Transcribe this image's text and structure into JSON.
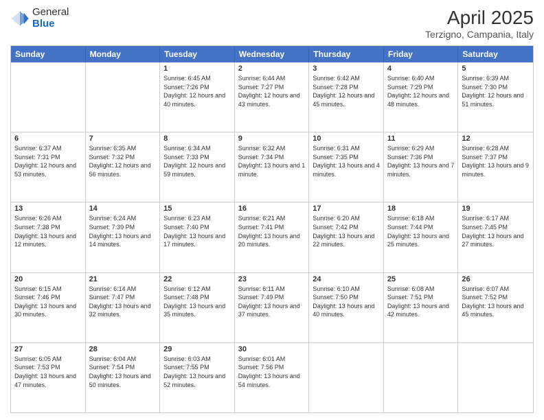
{
  "logo": {
    "general": "General",
    "blue": "Blue"
  },
  "title": "April 2025",
  "subtitle": "Terzigno, Campania, Italy",
  "weekdays": [
    "Sunday",
    "Monday",
    "Tuesday",
    "Wednesday",
    "Thursday",
    "Friday",
    "Saturday"
  ],
  "weeks": [
    [
      {
        "day": "",
        "info": ""
      },
      {
        "day": "",
        "info": ""
      },
      {
        "day": "1",
        "info": "Sunrise: 6:45 AM\nSunset: 7:26 PM\nDaylight: 12 hours and 40 minutes."
      },
      {
        "day": "2",
        "info": "Sunrise: 6:44 AM\nSunset: 7:27 PM\nDaylight: 12 hours and 43 minutes."
      },
      {
        "day": "3",
        "info": "Sunrise: 6:42 AM\nSunset: 7:28 PM\nDaylight: 12 hours and 45 minutes."
      },
      {
        "day": "4",
        "info": "Sunrise: 6:40 AM\nSunset: 7:29 PM\nDaylight: 12 hours and 48 minutes."
      },
      {
        "day": "5",
        "info": "Sunrise: 6:39 AM\nSunset: 7:30 PM\nDaylight: 12 hours and 51 minutes."
      }
    ],
    [
      {
        "day": "6",
        "info": "Sunrise: 6:37 AM\nSunset: 7:31 PM\nDaylight: 12 hours and 53 minutes."
      },
      {
        "day": "7",
        "info": "Sunrise: 6:35 AM\nSunset: 7:32 PM\nDaylight: 12 hours and 56 minutes."
      },
      {
        "day": "8",
        "info": "Sunrise: 6:34 AM\nSunset: 7:33 PM\nDaylight: 12 hours and 59 minutes."
      },
      {
        "day": "9",
        "info": "Sunrise: 6:32 AM\nSunset: 7:34 PM\nDaylight: 13 hours and 1 minute."
      },
      {
        "day": "10",
        "info": "Sunrise: 6:31 AM\nSunset: 7:35 PM\nDaylight: 13 hours and 4 minutes."
      },
      {
        "day": "11",
        "info": "Sunrise: 6:29 AM\nSunset: 7:36 PM\nDaylight: 13 hours and 7 minutes."
      },
      {
        "day": "12",
        "info": "Sunrise: 6:28 AM\nSunset: 7:37 PM\nDaylight: 13 hours and 9 minutes."
      }
    ],
    [
      {
        "day": "13",
        "info": "Sunrise: 6:26 AM\nSunset: 7:38 PM\nDaylight: 13 hours and 12 minutes."
      },
      {
        "day": "14",
        "info": "Sunrise: 6:24 AM\nSunset: 7:39 PM\nDaylight: 13 hours and 14 minutes."
      },
      {
        "day": "15",
        "info": "Sunrise: 6:23 AM\nSunset: 7:40 PM\nDaylight: 13 hours and 17 minutes."
      },
      {
        "day": "16",
        "info": "Sunrise: 6:21 AM\nSunset: 7:41 PM\nDaylight: 13 hours and 20 minutes."
      },
      {
        "day": "17",
        "info": "Sunrise: 6:20 AM\nSunset: 7:42 PM\nDaylight: 13 hours and 22 minutes."
      },
      {
        "day": "18",
        "info": "Sunrise: 6:18 AM\nSunset: 7:44 PM\nDaylight: 13 hours and 25 minutes."
      },
      {
        "day": "19",
        "info": "Sunrise: 6:17 AM\nSunset: 7:45 PM\nDaylight: 13 hours and 27 minutes."
      }
    ],
    [
      {
        "day": "20",
        "info": "Sunrise: 6:15 AM\nSunset: 7:46 PM\nDaylight: 13 hours and 30 minutes."
      },
      {
        "day": "21",
        "info": "Sunrise: 6:14 AM\nSunset: 7:47 PM\nDaylight: 13 hours and 32 minutes."
      },
      {
        "day": "22",
        "info": "Sunrise: 6:12 AM\nSunset: 7:48 PM\nDaylight: 13 hours and 35 minutes."
      },
      {
        "day": "23",
        "info": "Sunrise: 6:11 AM\nSunset: 7:49 PM\nDaylight: 13 hours and 37 minutes."
      },
      {
        "day": "24",
        "info": "Sunrise: 6:10 AM\nSunset: 7:50 PM\nDaylight: 13 hours and 40 minutes."
      },
      {
        "day": "25",
        "info": "Sunrise: 6:08 AM\nSunset: 7:51 PM\nDaylight: 13 hours and 42 minutes."
      },
      {
        "day": "26",
        "info": "Sunrise: 6:07 AM\nSunset: 7:52 PM\nDaylight: 13 hours and 45 minutes."
      }
    ],
    [
      {
        "day": "27",
        "info": "Sunrise: 6:05 AM\nSunset: 7:53 PM\nDaylight: 13 hours and 47 minutes."
      },
      {
        "day": "28",
        "info": "Sunrise: 6:04 AM\nSunset: 7:54 PM\nDaylight: 13 hours and 50 minutes."
      },
      {
        "day": "29",
        "info": "Sunrise: 6:03 AM\nSunset: 7:55 PM\nDaylight: 13 hours and 52 minutes."
      },
      {
        "day": "30",
        "info": "Sunrise: 6:01 AM\nSunset: 7:56 PM\nDaylight: 13 hours and 54 minutes."
      },
      {
        "day": "",
        "info": ""
      },
      {
        "day": "",
        "info": ""
      },
      {
        "day": "",
        "info": ""
      }
    ]
  ]
}
